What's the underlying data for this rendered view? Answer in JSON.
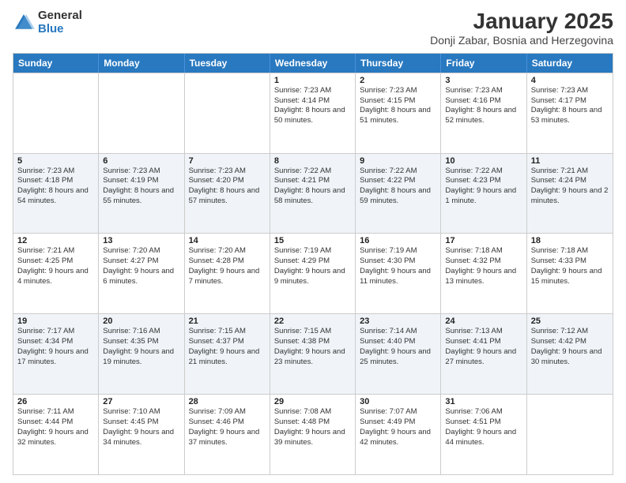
{
  "logo": {
    "general": "General",
    "blue": "Blue"
  },
  "header": {
    "month": "January 2025",
    "location": "Donji Zabar, Bosnia and Herzegovina"
  },
  "weekdays": [
    "Sunday",
    "Monday",
    "Tuesday",
    "Wednesday",
    "Thursday",
    "Friday",
    "Saturday"
  ],
  "rows": [
    [
      {
        "day": "",
        "sunrise": "",
        "sunset": "",
        "daylight": "",
        "even": false
      },
      {
        "day": "",
        "sunrise": "",
        "sunset": "",
        "daylight": "",
        "even": false
      },
      {
        "day": "",
        "sunrise": "",
        "sunset": "",
        "daylight": "",
        "even": false
      },
      {
        "day": "1",
        "sunrise": "Sunrise: 7:23 AM",
        "sunset": "Sunset: 4:14 PM",
        "daylight": "Daylight: 8 hours and 50 minutes.",
        "even": false
      },
      {
        "day": "2",
        "sunrise": "Sunrise: 7:23 AM",
        "sunset": "Sunset: 4:15 PM",
        "daylight": "Daylight: 8 hours and 51 minutes.",
        "even": false
      },
      {
        "day": "3",
        "sunrise": "Sunrise: 7:23 AM",
        "sunset": "Sunset: 4:16 PM",
        "daylight": "Daylight: 8 hours and 52 minutes.",
        "even": false
      },
      {
        "day": "4",
        "sunrise": "Sunrise: 7:23 AM",
        "sunset": "Sunset: 4:17 PM",
        "daylight": "Daylight: 8 hours and 53 minutes.",
        "even": false
      }
    ],
    [
      {
        "day": "5",
        "sunrise": "Sunrise: 7:23 AM",
        "sunset": "Sunset: 4:18 PM",
        "daylight": "Daylight: 8 hours and 54 minutes.",
        "even": true
      },
      {
        "day": "6",
        "sunrise": "Sunrise: 7:23 AM",
        "sunset": "Sunset: 4:19 PM",
        "daylight": "Daylight: 8 hours and 55 minutes.",
        "even": true
      },
      {
        "day": "7",
        "sunrise": "Sunrise: 7:23 AM",
        "sunset": "Sunset: 4:20 PM",
        "daylight": "Daylight: 8 hours and 57 minutes.",
        "even": true
      },
      {
        "day": "8",
        "sunrise": "Sunrise: 7:22 AM",
        "sunset": "Sunset: 4:21 PM",
        "daylight": "Daylight: 8 hours and 58 minutes.",
        "even": true
      },
      {
        "day": "9",
        "sunrise": "Sunrise: 7:22 AM",
        "sunset": "Sunset: 4:22 PM",
        "daylight": "Daylight: 8 hours and 59 minutes.",
        "even": true
      },
      {
        "day": "10",
        "sunrise": "Sunrise: 7:22 AM",
        "sunset": "Sunset: 4:23 PM",
        "daylight": "Daylight: 9 hours and 1 minute.",
        "even": true
      },
      {
        "day": "11",
        "sunrise": "Sunrise: 7:21 AM",
        "sunset": "Sunset: 4:24 PM",
        "daylight": "Daylight: 9 hours and 2 minutes.",
        "even": true
      }
    ],
    [
      {
        "day": "12",
        "sunrise": "Sunrise: 7:21 AM",
        "sunset": "Sunset: 4:25 PM",
        "daylight": "Daylight: 9 hours and 4 minutes.",
        "even": false
      },
      {
        "day": "13",
        "sunrise": "Sunrise: 7:20 AM",
        "sunset": "Sunset: 4:27 PM",
        "daylight": "Daylight: 9 hours and 6 minutes.",
        "even": false
      },
      {
        "day": "14",
        "sunrise": "Sunrise: 7:20 AM",
        "sunset": "Sunset: 4:28 PM",
        "daylight": "Daylight: 9 hours and 7 minutes.",
        "even": false
      },
      {
        "day": "15",
        "sunrise": "Sunrise: 7:19 AM",
        "sunset": "Sunset: 4:29 PM",
        "daylight": "Daylight: 9 hours and 9 minutes.",
        "even": false
      },
      {
        "day": "16",
        "sunrise": "Sunrise: 7:19 AM",
        "sunset": "Sunset: 4:30 PM",
        "daylight": "Daylight: 9 hours and 11 minutes.",
        "even": false
      },
      {
        "day": "17",
        "sunrise": "Sunrise: 7:18 AM",
        "sunset": "Sunset: 4:32 PM",
        "daylight": "Daylight: 9 hours and 13 minutes.",
        "even": false
      },
      {
        "day": "18",
        "sunrise": "Sunrise: 7:18 AM",
        "sunset": "Sunset: 4:33 PM",
        "daylight": "Daylight: 9 hours and 15 minutes.",
        "even": false
      }
    ],
    [
      {
        "day": "19",
        "sunrise": "Sunrise: 7:17 AM",
        "sunset": "Sunset: 4:34 PM",
        "daylight": "Daylight: 9 hours and 17 minutes.",
        "even": true
      },
      {
        "day": "20",
        "sunrise": "Sunrise: 7:16 AM",
        "sunset": "Sunset: 4:35 PM",
        "daylight": "Daylight: 9 hours and 19 minutes.",
        "even": true
      },
      {
        "day": "21",
        "sunrise": "Sunrise: 7:15 AM",
        "sunset": "Sunset: 4:37 PM",
        "daylight": "Daylight: 9 hours and 21 minutes.",
        "even": true
      },
      {
        "day": "22",
        "sunrise": "Sunrise: 7:15 AM",
        "sunset": "Sunset: 4:38 PM",
        "daylight": "Daylight: 9 hours and 23 minutes.",
        "even": true
      },
      {
        "day": "23",
        "sunrise": "Sunrise: 7:14 AM",
        "sunset": "Sunset: 4:40 PM",
        "daylight": "Daylight: 9 hours and 25 minutes.",
        "even": true
      },
      {
        "day": "24",
        "sunrise": "Sunrise: 7:13 AM",
        "sunset": "Sunset: 4:41 PM",
        "daylight": "Daylight: 9 hours and 27 minutes.",
        "even": true
      },
      {
        "day": "25",
        "sunrise": "Sunrise: 7:12 AM",
        "sunset": "Sunset: 4:42 PM",
        "daylight": "Daylight: 9 hours and 30 minutes.",
        "even": true
      }
    ],
    [
      {
        "day": "26",
        "sunrise": "Sunrise: 7:11 AM",
        "sunset": "Sunset: 4:44 PM",
        "daylight": "Daylight: 9 hours and 32 minutes.",
        "even": false
      },
      {
        "day": "27",
        "sunrise": "Sunrise: 7:10 AM",
        "sunset": "Sunset: 4:45 PM",
        "daylight": "Daylight: 9 hours and 34 minutes.",
        "even": false
      },
      {
        "day": "28",
        "sunrise": "Sunrise: 7:09 AM",
        "sunset": "Sunset: 4:46 PM",
        "daylight": "Daylight: 9 hours and 37 minutes.",
        "even": false
      },
      {
        "day": "29",
        "sunrise": "Sunrise: 7:08 AM",
        "sunset": "Sunset: 4:48 PM",
        "daylight": "Daylight: 9 hours and 39 minutes.",
        "even": false
      },
      {
        "day": "30",
        "sunrise": "Sunrise: 7:07 AM",
        "sunset": "Sunset: 4:49 PM",
        "daylight": "Daylight: 9 hours and 42 minutes.",
        "even": false
      },
      {
        "day": "31",
        "sunrise": "Sunrise: 7:06 AM",
        "sunset": "Sunset: 4:51 PM",
        "daylight": "Daylight: 9 hours and 44 minutes.",
        "even": false
      },
      {
        "day": "",
        "sunrise": "",
        "sunset": "",
        "daylight": "",
        "even": false
      }
    ]
  ]
}
